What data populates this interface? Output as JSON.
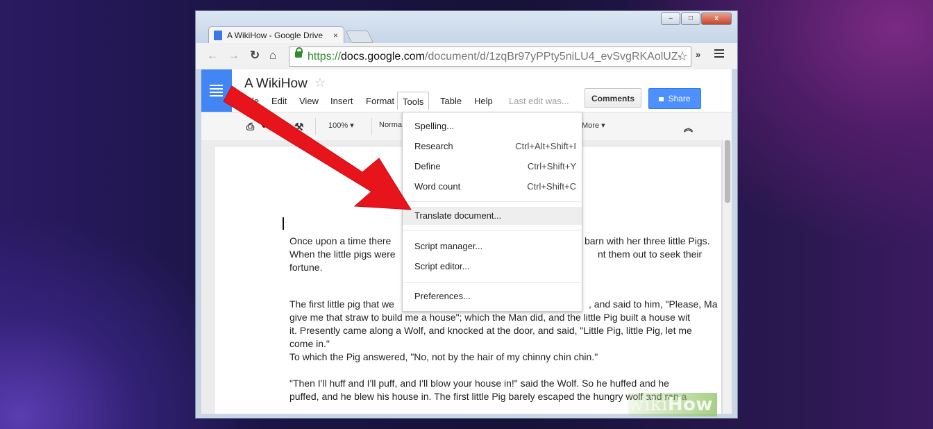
{
  "browser": {
    "tab_title": "A WikiHow - Google Drive",
    "tab_close": "×",
    "url_https": "https://",
    "url_domain": "docs.google.com",
    "url_path": "/document/d/1zqBr97yPPty5niLU4_evSvgRKAolUZ-",
    "ext_label": "»",
    "win_minimize": "–",
    "win_maximize": "□",
    "win_close": "x"
  },
  "docs": {
    "title": "A WikiHow",
    "menu": [
      "File",
      "Edit",
      "View",
      "Insert",
      "Format",
      "Tools",
      "Table",
      "Help"
    ],
    "last_edit": "Last edit was...",
    "comments_label": "Comments",
    "share_label": "Share",
    "zoom": "100%",
    "style": "Normal",
    "more_label": "More"
  },
  "tools_menu": {
    "items": [
      {
        "label": "Spelling...",
        "shortcut": ""
      },
      {
        "label": "Research",
        "shortcut": "Ctrl+Alt+Shift+I"
      },
      {
        "label": "Define",
        "shortcut": "Ctrl+Shift+Y"
      },
      {
        "label": "Word count",
        "shortcut": "Ctrl+Shift+C"
      },
      {
        "label": "Translate document...",
        "shortcut": ""
      },
      {
        "label": "Script manager...",
        "shortcut": ""
      },
      {
        "label": "Script editor...",
        "shortcut": ""
      },
      {
        "label": "Preferences...",
        "shortcut": ""
      }
    ],
    "highlighted": "Translate document..."
  },
  "document": {
    "paragraphs": [
      {
        "left": "Once upon a time there",
        "right": "barn with her three little Pigs."
      },
      {
        "left": "When the little pigs were",
        "right": "nt them out to seek their"
      },
      {
        "left": "fortune.",
        "right": ""
      },
      {
        "left": "The first little pig that we",
        "right": ", and said to him, \"Please, Ma"
      },
      {
        "left": "give me that straw to build me a house\"; which the Man did, and the little Pig built a house wit",
        "right": ""
      },
      {
        "left": "it. Presently came along a Wolf, and knocked at the door, and said, \"Little Pig, little Pig, let me",
        "right": ""
      },
      {
        "left": "come in.\"",
        "right": ""
      },
      {
        "left": "To which the Pig answered, \"No, not by the hair of my chinny chin chin.\"",
        "right": ""
      },
      {
        "left": "\"Then I'll huff and I'll puff, and I'll blow your house in!\" said the Wolf. So he huffed and he",
        "right": ""
      },
      {
        "left": "puffed, and he blew his house in. The first little Pig barely escaped the hungry wolf and ran a",
        "right": ""
      }
    ]
  },
  "watermark": {
    "wiki": "wiki",
    "how": "How"
  },
  "colors": {
    "arrow": "#e8141b",
    "docs_blue": "#4285f4",
    "share_blue": "#4d90fe"
  }
}
